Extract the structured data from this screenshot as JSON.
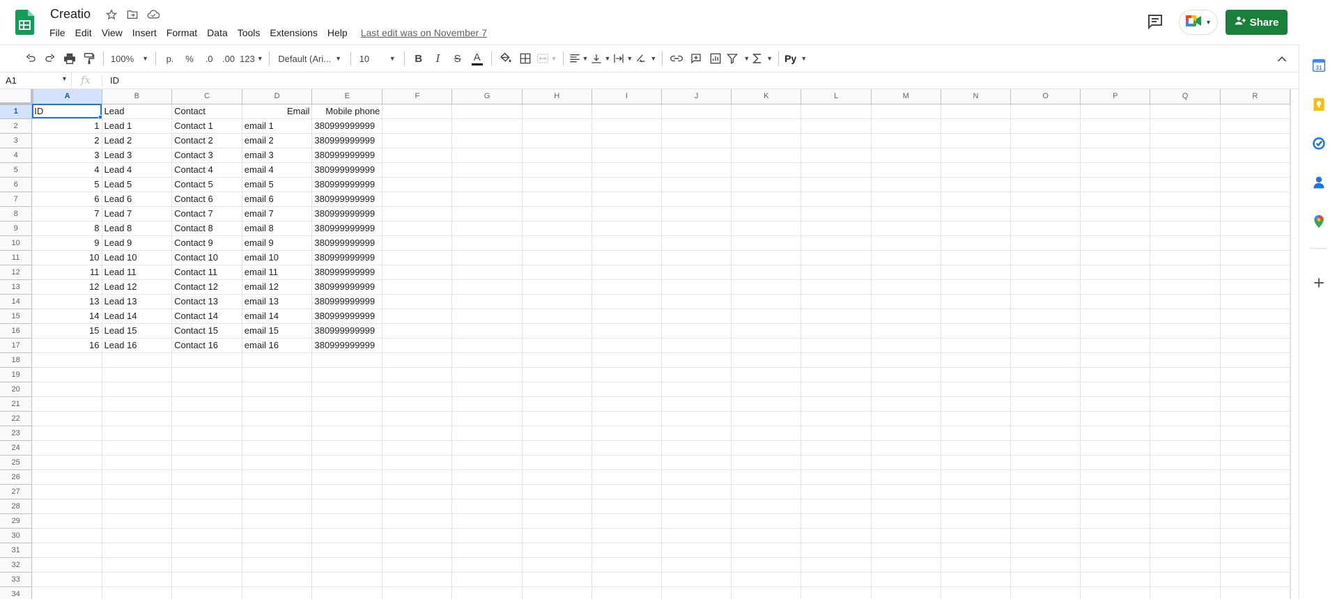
{
  "header": {
    "title": "Creatio",
    "last_edit": "Last edit was on November 7",
    "share_label": "Share",
    "menu": [
      "File",
      "Edit",
      "View",
      "Insert",
      "Format",
      "Data",
      "Tools",
      "Extensions",
      "Help"
    ]
  },
  "toolbar": {
    "zoom": "100%",
    "currency": "р.",
    "percent": "%",
    "decrease_decimal": ".0",
    "increase_decimal": ".00",
    "number_format": "123",
    "font": "Default (Ari...",
    "font_size": "10",
    "bold": "B",
    "italic": "I",
    "strike": "S",
    "text_color": "A",
    "input_tools": "Pу"
  },
  "formula_bar": {
    "cell_ref": "A1",
    "fx": "fx",
    "value": "ID"
  },
  "grid": {
    "columns": [
      "A",
      "B",
      "C",
      "D",
      "E",
      "F",
      "G",
      "H",
      "I",
      "J",
      "K",
      "L",
      "M",
      "N",
      "O",
      "P",
      "Q",
      "R"
    ],
    "row_count": 34,
    "header_row": [
      "ID",
      "Lead",
      "Contact",
      "Email",
      "Mobile phone"
    ],
    "rows": [
      [
        "1",
        "Lead 1",
        "Contact 1",
        "email 1",
        "380999999999"
      ],
      [
        "2",
        "Lead 2",
        "Contact 2",
        "email 2",
        "380999999999"
      ],
      [
        "3",
        "Lead 3",
        "Contact 3",
        "email 3",
        "380999999999"
      ],
      [
        "4",
        "Lead 4",
        "Contact 4",
        "email 4",
        "380999999999"
      ],
      [
        "5",
        "Lead 5",
        "Contact 5",
        "email 5",
        "380999999999"
      ],
      [
        "6",
        "Lead 6",
        "Contact 6",
        "email 6",
        "380999999999"
      ],
      [
        "7",
        "Lead 7",
        "Contact 7",
        "email 7",
        "380999999999"
      ],
      [
        "8",
        "Lead 8",
        "Contact 8",
        "email 8",
        "380999999999"
      ],
      [
        "9",
        "Lead 9",
        "Contact 9",
        "email 9",
        "380999999999"
      ],
      [
        "10",
        "Lead 10",
        "Contact 10",
        "email 10",
        "380999999999"
      ],
      [
        "11",
        "Lead 11",
        "Contact 11",
        "email 11",
        "380999999999"
      ],
      [
        "12",
        "Lead 12",
        "Contact 12",
        "email 12",
        "380999999999"
      ],
      [
        "13",
        "Lead 13",
        "Contact 13",
        "email 13",
        "380999999999"
      ],
      [
        "14",
        "Lead 14",
        "Contact 14",
        "email 14",
        "380999999999"
      ],
      [
        "15",
        "Lead 15",
        "Contact 15",
        "email 15",
        "380999999999"
      ],
      [
        "16",
        "Lead 16",
        "Contact 16",
        "email 16",
        "380999999999"
      ]
    ]
  },
  "side_panel": [
    "calendar-icon",
    "keep-icon",
    "tasks-icon",
    "contacts-icon",
    "maps-icon",
    "add-icon"
  ],
  "colors": {
    "brand_green": "#188038",
    "selection_blue": "#1a73e8",
    "header_bg": "#f8f9fa"
  }
}
